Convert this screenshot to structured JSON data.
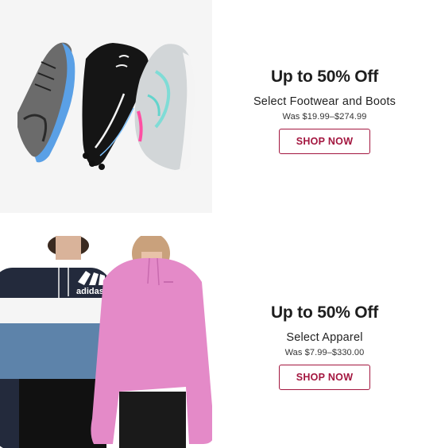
{
  "promos": [
    {
      "image_alt": "Athletic footwear and cleats",
      "headline": "Up to 50% Off",
      "subhead": "Select Footwear and Boots",
      "price_range": "Was $19.99–$274.99",
      "cta_label": "SHOP NOW"
    },
    {
      "image_alt": "Models wearing hoodies",
      "headline": "Up to 50% Off",
      "subhead": "Select Apparel",
      "price_range": "Was $7.99–$330.00",
      "cta_label": "SHOP NOW"
    }
  ],
  "brand_marks": {
    "hoodie_logo": "adidas"
  },
  "colors": {
    "cta_accent": "#a3163f",
    "image_bg": "#f5f5f5"
  }
}
